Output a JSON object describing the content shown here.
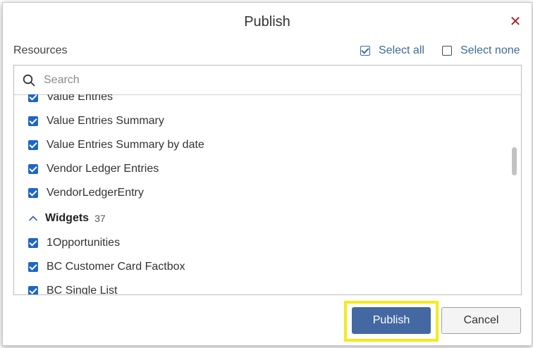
{
  "dialog": {
    "title": "Publish",
    "close_glyph": "✕",
    "resources_label": "Resources",
    "select_all_label": "Select all",
    "select_none_label": "Select none"
  },
  "search": {
    "placeholder": "Search",
    "value": ""
  },
  "items": {
    "value_entries": "Value Entries",
    "value_entries_summary": "Value Entries Summary",
    "value_entries_summary_by_date": "Value Entries Summary by date",
    "vendor_ledger_entries": "Vendor Ledger Entries",
    "vendorledgerentry": "VendorLedgerEntry",
    "opportunities": "1Opportunities",
    "bc_customer_card_factbox": "BC Customer Card Factbox",
    "bc_single_list": "BC Single List"
  },
  "group": {
    "name": "Widgets",
    "count": "37",
    "expanded": true
  },
  "checked": {
    "select_all": true,
    "select_none": false,
    "all_items": true
  },
  "buttons": {
    "publish": "Publish",
    "cancel": "Cancel"
  },
  "colors": {
    "accent": "#4468a2",
    "checkbox": "#1e66c8",
    "highlight": "#f5ea1a",
    "close": "#a4262c"
  },
  "icons": {
    "search": "search-icon",
    "close": "close-icon",
    "chevron": "chevron-up-icon"
  }
}
